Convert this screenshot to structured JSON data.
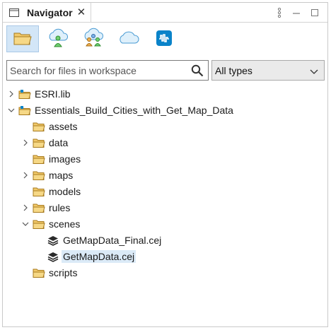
{
  "tab": {
    "title": "Navigator"
  },
  "toolbar": {
    "buttons": [
      {
        "icon": "folder-icon",
        "active": true
      },
      {
        "icon": "cloud-user-icon",
        "active": false
      },
      {
        "icon": "cloud-group-icon",
        "active": false
      },
      {
        "icon": "cloud-icon",
        "active": false
      },
      {
        "icon": "data-waveform-icon",
        "active": false
      }
    ]
  },
  "search": {
    "placeholder": "Search for files in workspace",
    "value": ""
  },
  "filter": {
    "selected": "All types"
  },
  "tree": {
    "items": [
      {
        "label": "ESRI.lib"
      },
      {
        "label": "Essentials_Build_Cities_with_Get_Map_Data"
      },
      {
        "label": "assets"
      },
      {
        "label": "data"
      },
      {
        "label": "images"
      },
      {
        "label": "maps"
      },
      {
        "label": "models"
      },
      {
        "label": "rules"
      },
      {
        "label": "scenes"
      },
      {
        "label": "GetMapData_Final.cej"
      },
      {
        "label": "GetMapData.cej"
      },
      {
        "label": "scripts"
      }
    ]
  },
  "colors": {
    "accent": "#0a83c9",
    "folder": "#e8b64a",
    "selection": "#dbeaf7"
  }
}
